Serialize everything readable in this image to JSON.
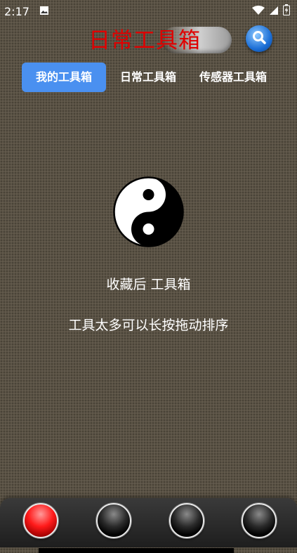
{
  "status": {
    "time": "2:17",
    "icons": [
      "image-icon",
      "wifi-icon",
      "signal-icon",
      "battery-icon"
    ]
  },
  "header": {
    "title": "日常工具箱",
    "title_color": "#e00000",
    "search_icon": "search-icon"
  },
  "tabs": [
    {
      "label": "我的工具箱",
      "active": true
    },
    {
      "label": "日常工具箱",
      "active": false
    },
    {
      "label": "传感器工具箱",
      "active": false
    }
  ],
  "main": {
    "emblem": "yin-yang-icon",
    "line1": "收藏后                    工具箱",
    "line2": "工具太多可以长按拖动排序"
  },
  "bottom_nav": [
    {
      "name": "nav-button-1",
      "color": "red",
      "selected": true
    },
    {
      "name": "nav-button-2",
      "color": "black",
      "selected": false
    },
    {
      "name": "nav-button-3",
      "color": "black",
      "selected": false
    },
    {
      "name": "nav-button-4",
      "color": "black",
      "selected": false
    }
  ]
}
